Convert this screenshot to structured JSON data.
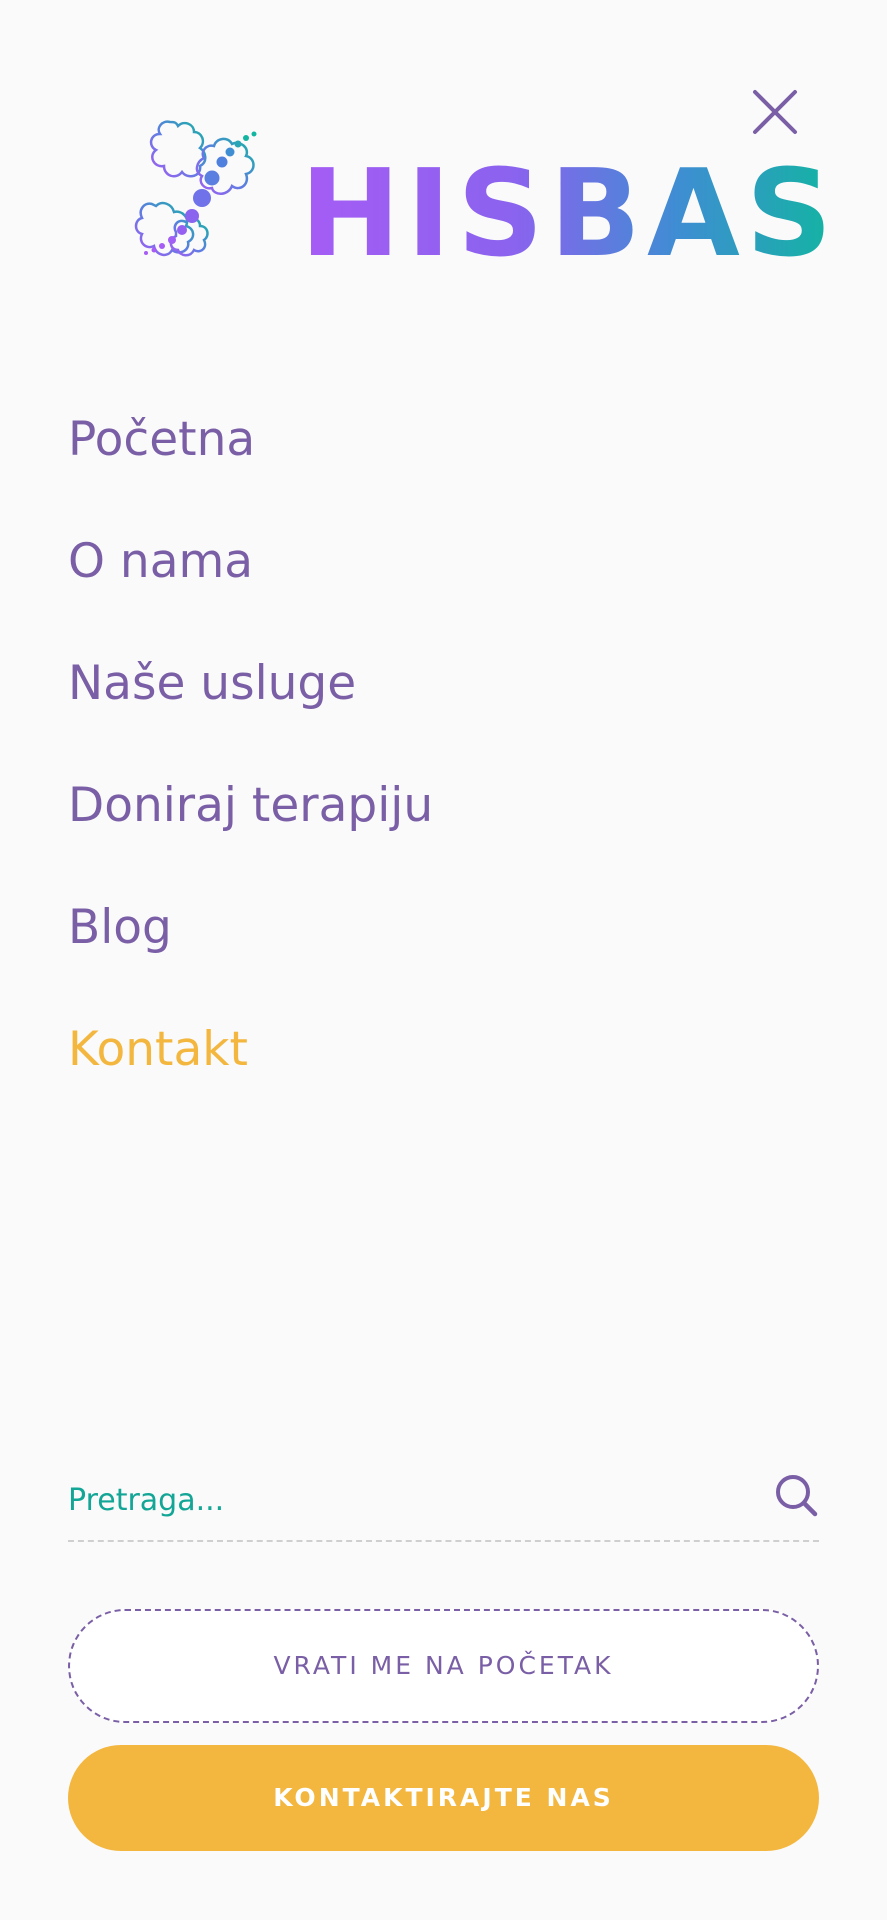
{
  "header": {
    "logo_text": "HISBAS",
    "close_icon": "close-icon",
    "logo_icon": "butterfly-logo-icon"
  },
  "nav": {
    "items": [
      {
        "label": "Početna",
        "active": false
      },
      {
        "label": "O nama",
        "active": false
      },
      {
        "label": "Naše usluge",
        "active": false
      },
      {
        "label": "Doniraj terapiju",
        "active": false
      },
      {
        "label": "Blog",
        "active": false
      },
      {
        "label": "Kontakt",
        "active": true
      }
    ]
  },
  "search": {
    "placeholder": "Pretraga...",
    "value": "",
    "icon": "search-icon"
  },
  "buttons": {
    "back_to_top": "VRATI ME NA POČETAK",
    "contact_us": "KONTAKTIRAJTE NAS"
  },
  "colors": {
    "primary_purple": "#7a5fa6",
    "accent_yellow": "#f3b73f",
    "teal": "#13a596",
    "background": "#fafafa"
  }
}
